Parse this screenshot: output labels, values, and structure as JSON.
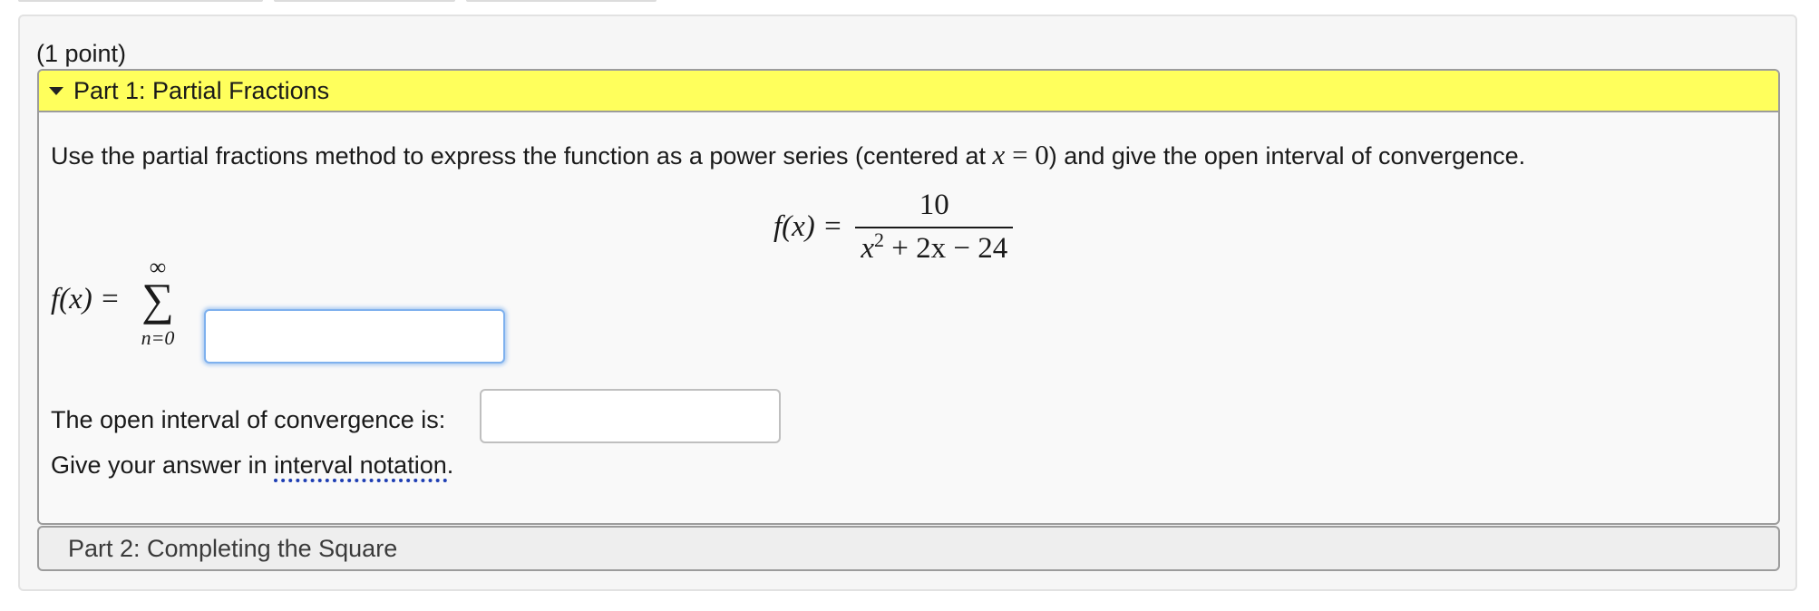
{
  "problem": {
    "points": "(1 point)",
    "part1": {
      "title": "Part 1: Partial Fractions",
      "instructions_before": "Use the partial fractions method to express the function as a power series (centered at ",
      "center_var": "x",
      "center_eq": " = 0",
      "instructions_after": ") and give the open interval of convergence.",
      "formula": {
        "lhs": "f(x) =",
        "numerator": "10",
        "denominator_a": "x",
        "denominator_exp": "2",
        "denominator_b": " + 2x − 24"
      },
      "series": {
        "lhs": "f(x) =",
        "upper": "∞",
        "sigma": "∑",
        "lower": "n=0",
        "input_value": ""
      },
      "interval": {
        "label": "The open interval of convergence is:",
        "input_value": "",
        "notation_before": "Give your answer in ",
        "notation_link": "interval notation",
        "notation_after": "."
      }
    },
    "part2": {
      "title": "Part 2: Completing the Square"
    }
  }
}
